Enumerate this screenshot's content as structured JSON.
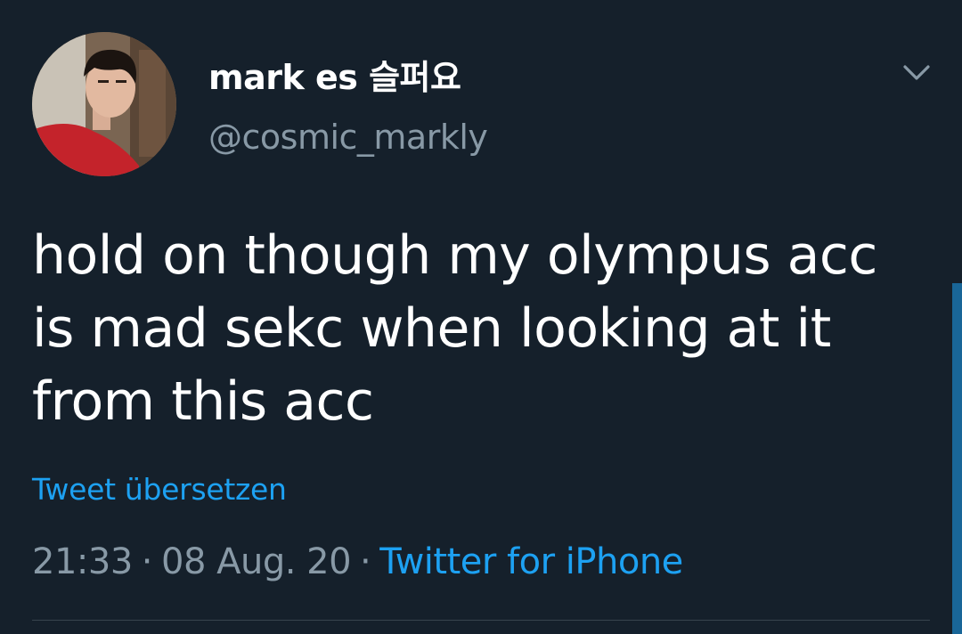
{
  "author": {
    "display_name": "mark es 슬퍼요",
    "handle": "@cosmic_markly"
  },
  "tweet": {
    "text": "hold on though my olympus acc is mad sekc when looking at it from this acc",
    "translate_label": "Tweet übersetzen",
    "time": "21:33",
    "separator": "·",
    "date": "08 Aug. 20",
    "source": "Twitter for iPhone"
  },
  "icons": {
    "more_menu": "chevron-down-icon",
    "avatar": "user-avatar"
  },
  "colors": {
    "background": "#15202b",
    "primary_text": "#ffffff",
    "secondary_text": "#8899a6",
    "accent": "#1da1f2",
    "divider": "#38444d"
  }
}
